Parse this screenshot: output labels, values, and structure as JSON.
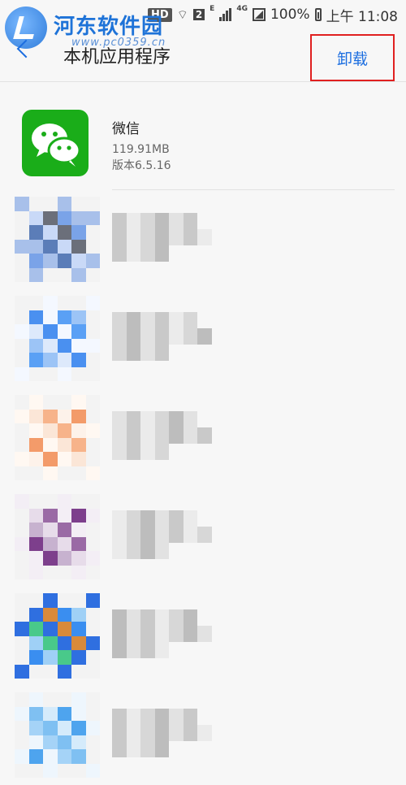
{
  "status_bar": {
    "hd": "HD",
    "sim": "2",
    "net1": "E",
    "net2": "4G",
    "battery": "100%",
    "time": "上午 11:08"
  },
  "watermark": {
    "title": "河东软件园",
    "url": "www.pc0359.cn"
  },
  "header": {
    "title": "本机应用程序",
    "action_label": "卸载",
    "action_highlight_color": "#e02020",
    "accent_color": "#1c6ee0"
  },
  "apps": [
    {
      "name": "微信",
      "size": "119.91MB",
      "version": "版本6.5.16",
      "icon": "wechat-icon",
      "icon_color": "#1aad19"
    }
  ],
  "blurred_apps": [
    {
      "icon": "blurred-app-icon",
      "palette": [
        "#c9d9f7",
        "#7aa3e8",
        "#5b7db8",
        "#6b6f7a",
        "#a8c0ea"
      ]
    },
    {
      "icon": "blurred-app-icon",
      "palette": [
        "#9cc4f6",
        "#4a90f0",
        "#5aa0f5",
        "#dde9fb",
        "#f4f8ff"
      ]
    },
    {
      "icon": "blurred-app-icon",
      "palette": [
        "#f7b38a",
        "#f39b6a",
        "#fbe6d7",
        "#fdf2ea",
        "#fff8f2"
      ]
    },
    {
      "icon": "blurred-app-icon",
      "palette": [
        "#c7b2cf",
        "#9a6aa5",
        "#7d3f8c",
        "#e7dcea",
        "#f3eef5"
      ]
    },
    {
      "icon": "blurred-app-icon",
      "palette": [
        "#3a8ef0",
        "#49c98a",
        "#d98a3a",
        "#9fd0f6",
        "#2f6fe0"
      ]
    },
    {
      "icon": "blurred-app-icon",
      "palette": [
        "#7fc0f2",
        "#4ea4ee",
        "#a5d3f7",
        "#d5ebfb",
        "#eef6fd"
      ]
    }
  ]
}
